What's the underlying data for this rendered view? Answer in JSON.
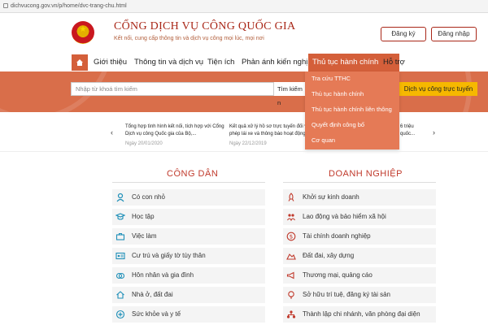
{
  "browser": {
    "url": "dichvucong.gov.vn/p/home/dvc-trang-chu.html"
  },
  "header": {
    "title": "CỔNG DỊCH VỤ CÔNG QUỐC GIA",
    "subtitle": "Kết nối, cung cấp thông tin và dịch vụ công mọi lúc, mọi nơi",
    "register": "Đăng ký",
    "login": "Đăng nhập"
  },
  "nav": {
    "items": [
      "Giới thiệu",
      "Thông tin và dịch vụ",
      "Tiện ích",
      "Phản ánh kiến nghị",
      "Thủ tục hành chính",
      "Hỗ trợ"
    ],
    "active_index": 4
  },
  "dropdown": {
    "items": [
      "Tra cứu TTHC",
      "Thủ tục hành chính",
      "Thủ tục hành chính liên thông",
      "Quyết định công bố",
      "Cơ quan"
    ]
  },
  "search": {
    "placeholder": "Nhập từ khoá tìm kiếm",
    "advanced": "Tìm kiếm n",
    "service_button": "Dịch vụ công trực tuyến"
  },
  "news": [
    {
      "title": "Tổng hợp tình hình kết nối, tích hợp với Cổng Dịch vụ công Quốc gia của Bộ,...",
      "date": "Ngày 20/01/2020"
    },
    {
      "title": "Kết quả xử lý hồ sơ trực tuyến đối với giấy phép lái xe và thông báo hoạt động...",
      "date": "Ngày 22/12/2019"
    },
    {
      "title": "6 triệu quốc..."
    }
  ],
  "citizen": {
    "title": "CÔNG DÂN",
    "items": [
      "Có con nhỏ",
      "Học tập",
      "Việc làm",
      "Cư trú và giấy tờ tùy thân",
      "Hôn nhân và gia đình",
      "Nhà ở, đất đai",
      "Sức khỏe và y tế"
    ]
  },
  "business": {
    "title": "DOANH NGHIỆP",
    "items": [
      "Khởi sự kinh doanh",
      "Lao động và bảo hiểm xã hội",
      "Tài chính doanh nghiệp",
      "Đất đai, xây dựng",
      "Thương mại, quảng cáo",
      "Sở hữu trí tuệ, đăng ký tài sản",
      "Thành lập chi nhánh, văn phòng đại diện"
    ]
  },
  "colors": {
    "brand": "#a92718",
    "nav_active": "#d45f3a",
    "banner": "#d96e4a",
    "service_button": "#f6b800",
    "citizen_icon": "#1e8fb8",
    "business_icon": "#c0392b"
  }
}
